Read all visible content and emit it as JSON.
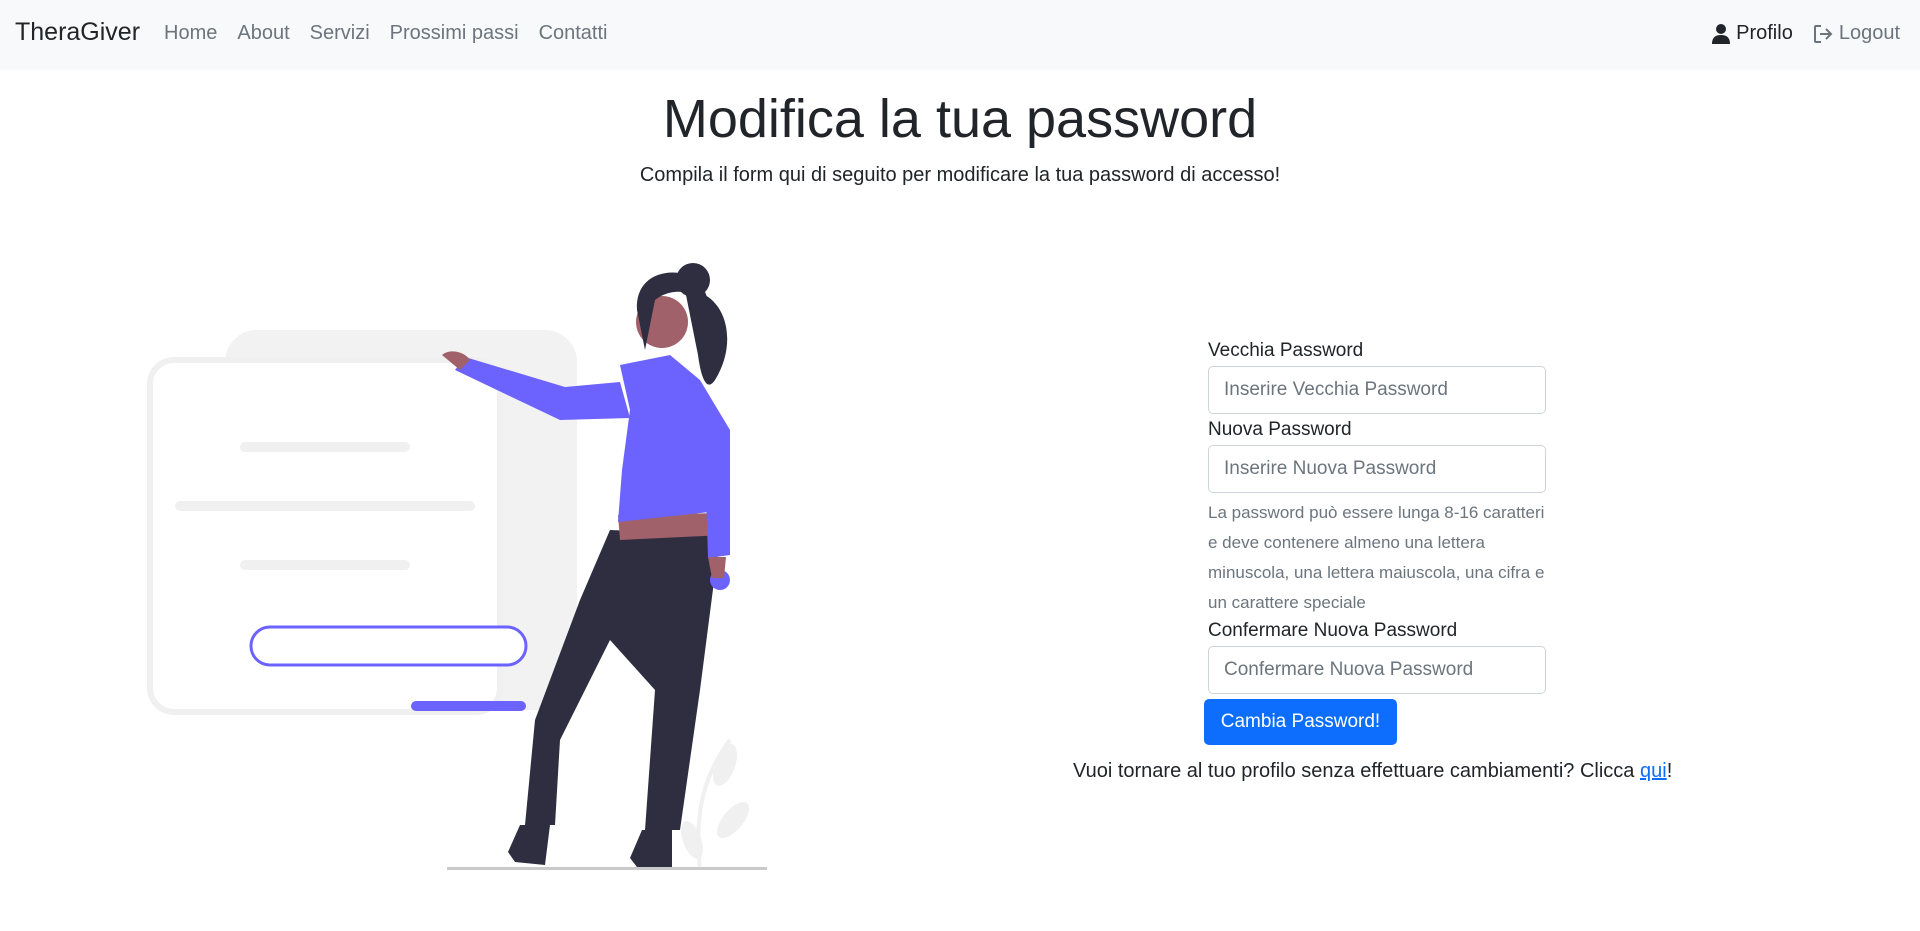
{
  "navbar": {
    "brand": "TheraGiver",
    "links": [
      "Home",
      "About",
      "Servizi",
      "Prossimi passi",
      "Contatti"
    ],
    "profile_label": "Profilo",
    "logout_label": "Logout"
  },
  "header": {
    "title": "Modifica la tua password",
    "subtitle": "Compila il form qui di seguito per modificare la tua password di accesso!"
  },
  "form": {
    "old_password_label": "Vecchia Password",
    "old_password_placeholder": "Inserire Vecchia Password",
    "new_password_label": "Nuova Password",
    "new_password_placeholder": "Inserire Nuova Password",
    "help_text": "La password può essere lunga 8-16 caratteri e deve contenere almeno una lettera minuscola, una lettera maiuscola, una cifra e un carattere speciale",
    "confirm_password_label": "Confermare Nuova Password",
    "confirm_password_placeholder": "Confermare Nuova Password",
    "submit_label": "Cambia Password!"
  },
  "back": {
    "prefix": "Vuoi tornare al tuo profilo senza effettuare cambiamenti? Clicca ",
    "link_label": "qui",
    "suffix": "!"
  },
  "colors": {
    "accent": "#6c63ff",
    "primary": "#0d6efd",
    "dark": "#2f2e41",
    "skin": "#a0616a"
  },
  "icons": {
    "profile": "person-icon",
    "logout": "logout-icon"
  }
}
